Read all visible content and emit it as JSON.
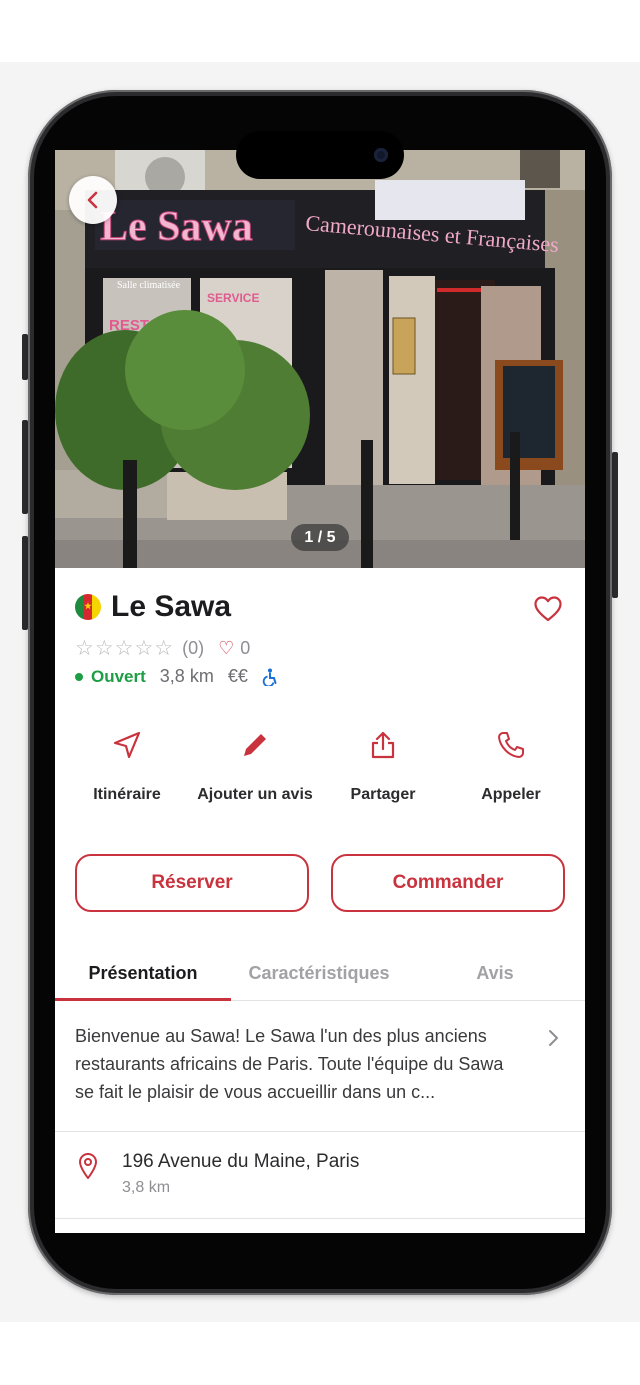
{
  "hero": {
    "photo_counter": "1 / 5",
    "sign_text": "Le Sawa",
    "sign_subtext": "Camerounaises et Françaises",
    "window_text_1": "Salle climatisée",
    "window_text_2": "RESTAURANT",
    "window_text_3": "SERVICE"
  },
  "restaurant": {
    "name": "Le Sawa",
    "flag": "cameroon-flag",
    "rating_stars": "☆☆☆☆☆",
    "rating_value": 0,
    "rating_count": "(0)",
    "likes": "0",
    "status": "Ouvert",
    "distance": "3,8 km",
    "price": "€€",
    "accessible_icon": "wheelchair-icon"
  },
  "actions": [
    {
      "label": "Itinéraire",
      "icon": "navigation-icon"
    },
    {
      "label": "Ajouter un avis",
      "icon": "pencil-icon"
    },
    {
      "label": "Partager",
      "icon": "share-icon"
    },
    {
      "label": "Appeler",
      "icon": "phone-icon"
    }
  ],
  "cta": {
    "reserve": "Réserver",
    "order": "Commander"
  },
  "tabs": [
    {
      "label": "Présentation",
      "active": true
    },
    {
      "label": "Caractéristiques",
      "active": false
    },
    {
      "label": "Avis",
      "active": false
    }
  ],
  "presentation": {
    "description": "Bienvenue au Sawa! Le Sawa l'un des plus anciens restaurants africains de Paris. Toute l'équipe du Sawa se fait le plaisir de vous accueillir dans un c..."
  },
  "address": {
    "street": "196 Avenue du Maine, Paris",
    "distance": "3,8 km"
  },
  "colors": {
    "accent": "#c9333e",
    "open": "#1e9e44",
    "accessible": "#1a6fd8"
  }
}
